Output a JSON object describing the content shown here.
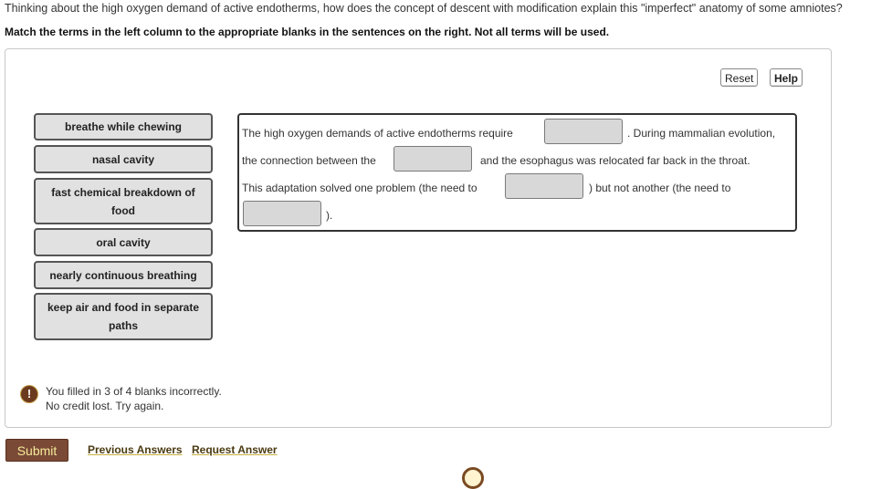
{
  "question": "Thinking about the high oxygen demand of active endotherms, how does the concept of descent with modification explain this \"imperfect\" anatomy of some amniotes?",
  "instructions": "Match the terms in the left column to the appropriate blanks in the sentences on the right. Not all terms will be used.",
  "toolbar": {
    "reset_label": "Reset",
    "help_label": "Help"
  },
  "terms": [
    {
      "label": "breathe while chewing"
    },
    {
      "label": "nasal cavity"
    },
    {
      "label": "fast chemical breakdown of food"
    },
    {
      "label": "oral cavity"
    },
    {
      "label": "nearly continuous breathing"
    },
    {
      "label": "keep air and food in separate paths"
    }
  ],
  "sentences": {
    "s1_before": "The high oxygen demands of active endotherms require",
    "s1_after": ". During mammalian evolution,",
    "s2_before": "the connection between the",
    "s2_after": "and the esophagus was relocated far back in the throat.",
    "s3_before": "This adaptation solved one problem (the need to",
    "s3_after": ") but not another (the need to",
    "s4_after": ")."
  },
  "blanks": [
    {
      "value": ""
    },
    {
      "value": ""
    },
    {
      "value": ""
    },
    {
      "value": ""
    }
  ],
  "feedback": {
    "icon": "exclamation-icon",
    "line1": "You filled in 3 of 4 blanks incorrectly.",
    "line2": "No credit lost. Try again."
  },
  "actions": {
    "submit_label": "Submit",
    "previous_answers_label": "Previous Answers",
    "request_answer_label": "Request Answer"
  },
  "colors": {
    "submit_bg": "#7a4a36",
    "submit_text": "#f5ea9a",
    "feedback_icon": "#6b3a1f"
  }
}
